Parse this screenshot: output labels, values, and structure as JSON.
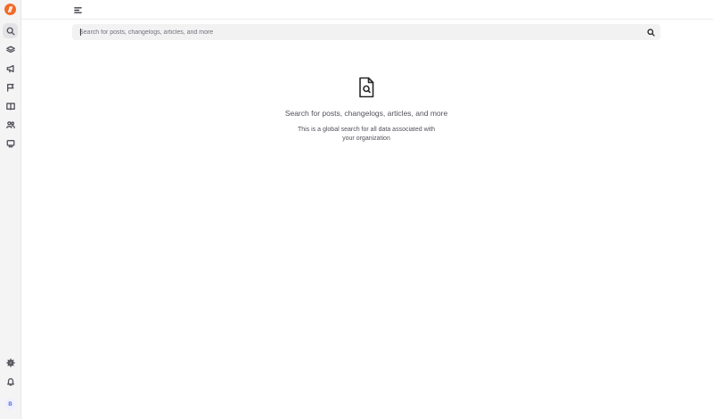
{
  "sidebar": {
    "logo_icon": "brand-logo-icon",
    "brand_color": "#f26b2a",
    "nav_items": [
      {
        "name": "search",
        "icon": "search-icon",
        "active": true
      },
      {
        "name": "layers",
        "icon": "layers-icon",
        "active": false
      },
      {
        "name": "announcements",
        "icon": "megaphone-icon",
        "active": false
      },
      {
        "name": "roadmap",
        "icon": "flag-icon",
        "active": false
      },
      {
        "name": "help-center",
        "icon": "book-icon",
        "active": false
      },
      {
        "name": "users",
        "icon": "users-icon",
        "active": false
      },
      {
        "name": "widgets",
        "icon": "monitor-icon",
        "active": false
      }
    ],
    "bottom_items": [
      {
        "name": "settings",
        "icon": "gear-icon"
      },
      {
        "name": "notifications",
        "icon": "bell-icon"
      }
    ],
    "avatar_initial": "B"
  },
  "topbar": {
    "menu_icon": "menu-toggle-icon"
  },
  "search": {
    "placeholder": "Search for posts, changelogs, articles, and more",
    "value": "",
    "submit_icon": "search-icon"
  },
  "empty_state": {
    "icon": "document-search-icon",
    "title": "Search for posts, changelogs, articles, and more",
    "description": "This is a global search for all data associated with your organization"
  }
}
